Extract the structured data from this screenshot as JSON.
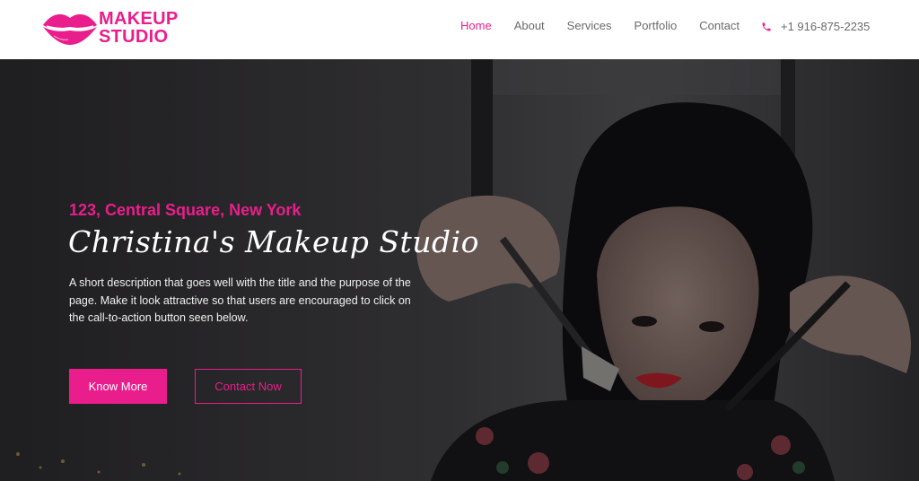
{
  "brand": {
    "line1": "MAKEUP",
    "line2": "STUDIO",
    "accent_color": "#e91e8c",
    "logo_icon": "lips-icon"
  },
  "nav": {
    "items": [
      {
        "label": "Home",
        "active": true
      },
      {
        "label": "About",
        "active": false
      },
      {
        "label": "Services",
        "active": false
      },
      {
        "label": "Portfolio",
        "active": false
      },
      {
        "label": "Contact",
        "active": false
      }
    ]
  },
  "phone": {
    "icon": "phone-icon",
    "number": "+1 916-875-2235"
  },
  "hero": {
    "address": "123, Central Square, New York",
    "title": "Christina's Makeup Studio",
    "description": "A short description that goes well with the title and the purpose of the page. Make it look attractive so that users are encouraged to click on the call-to-action button seen below.",
    "primary_button": "Know More",
    "secondary_button": "Contact Now"
  }
}
